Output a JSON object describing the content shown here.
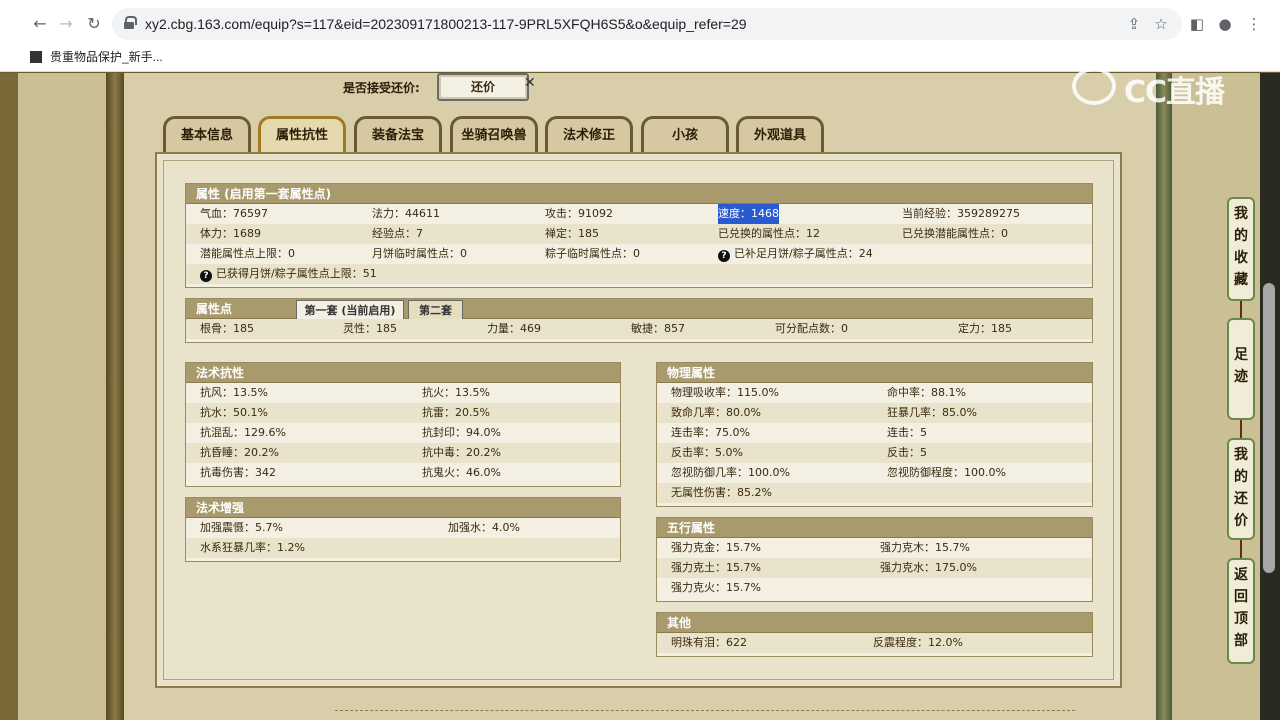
{
  "browser": {
    "url": "xy2.cbg.163.com/equip?s=117&eid=202309171800213-117-9PRL5XFQH6S5&o&equip_refer=29",
    "bookmark": "贵重物品保护_新手..."
  },
  "watermark": "CC直播",
  "counter_offer": {
    "label": "是否接受还价:",
    "button": "还价"
  },
  "tabs": [
    "基本信息",
    "属性抗性",
    "装备法宝",
    "坐骑召唤兽",
    "法术修正",
    "小孩",
    "外观道具"
  ],
  "attributes": {
    "title": "属性 (启用第一套属性点)",
    "rows": [
      [
        "气血：76597",
        "法力：44611",
        "攻击：91092",
        "速度：1468",
        "当前经验：359289275"
      ],
      [
        "体力：1689",
        "经验点：7",
        "禅定：185",
        "已兑换的属性点：12",
        "已兑换潜能属性点：0"
      ],
      [
        "潜能属性点上限：0",
        "月饼临时属性点：0",
        "粽子临时属性点：0",
        "已补足月饼/粽子属性点：24",
        ""
      ],
      [
        "已获得月饼/粽子属性点上限：51",
        "",
        "",
        "",
        ""
      ]
    ]
  },
  "points": {
    "title": "属性点",
    "subtabs": [
      "第一套 (当前启用)",
      "第二套"
    ],
    "values": [
      "根骨：185",
      "灵性：185",
      "力量：469",
      "敏捷：857",
      "可分配点数：0",
      "定力：185"
    ]
  },
  "resist": {
    "title": "法术抗性",
    "rows": [
      [
        "抗风：13.5%",
        "抗火：13.5%"
      ],
      [
        "抗水：50.1%",
        "抗雷：20.5%"
      ],
      [
        "抗混乱：129.6%",
        "抗封印：94.0%"
      ],
      [
        "抗昏睡：20.2%",
        "抗中毒：20.2%"
      ],
      [
        "抗毒伤害：342",
        "抗鬼火：46.0%"
      ]
    ]
  },
  "enhance": {
    "title": "法术增强",
    "rows": [
      [
        "加强震慑：5.7%",
        "加强水：4.0%"
      ],
      [
        "水系狂暴几率：1.2%",
        ""
      ]
    ]
  },
  "physical": {
    "title": "物理属性",
    "rows": [
      [
        "物理吸收率：115.0%",
        "命中率：88.1%"
      ],
      [
        "致命几率：80.0%",
        "狂暴几率：85.0%"
      ],
      [
        "连击率：75.0%",
        "连击：5"
      ],
      [
        "反击率：5.0%",
        "反击：5"
      ],
      [
        "忽视防御几率：100.0%",
        "忽视防御程度：100.0%"
      ],
      [
        "无属性伤害：85.2%",
        ""
      ]
    ]
  },
  "elements": {
    "title": "五行属性",
    "rows": [
      [
        "强力克金：15.7%",
        "强力克木：15.7%"
      ],
      [
        "强力克土：15.7%",
        "强力克水：175.0%"
      ],
      [
        "强力克火：15.7%",
        ""
      ]
    ]
  },
  "other": {
    "title": "其他",
    "rows": [
      [
        "明珠有泪：622",
        "反震程度：12.0%"
      ]
    ]
  },
  "side": [
    "我的收藏",
    "足迹",
    "我的还价",
    "返回顶部"
  ]
}
